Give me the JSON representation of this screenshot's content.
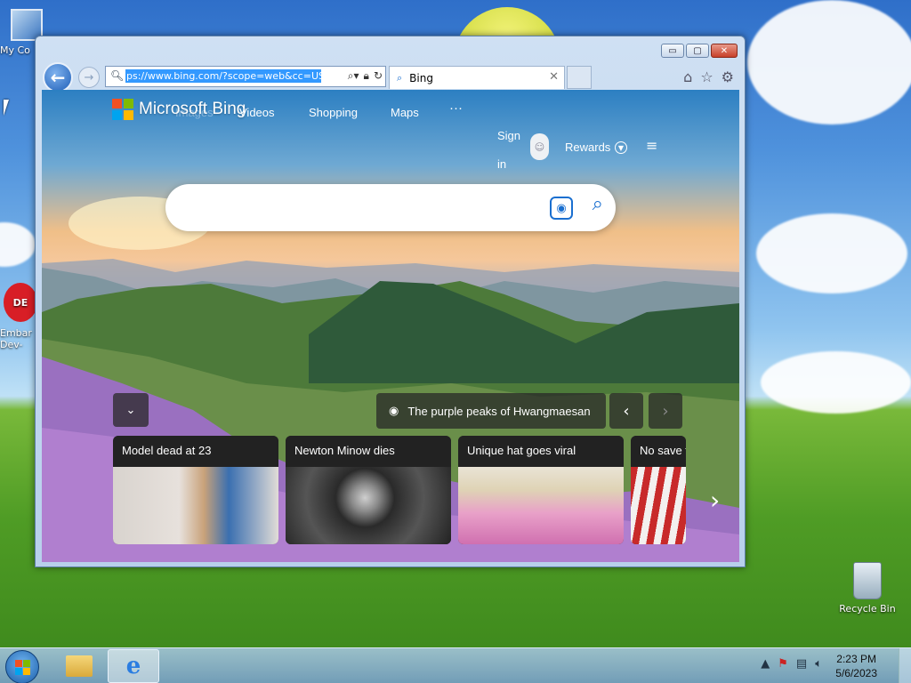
{
  "desktop": {
    "icons": [
      {
        "label": "My Co"
      },
      {
        "label": "Embar Dev-"
      },
      {
        "label": "Recycle Bin"
      }
    ]
  },
  "window": {
    "caption_buttons": {
      "minimize": "▭",
      "maximize": "▢",
      "close": "✕"
    },
    "address": {
      "url": "ps://www.bing.com/?scope=web&cc=US"
    },
    "tab": {
      "title": "Bing",
      "close": "✕"
    }
  },
  "bing": {
    "logo_text": "Microsoft Bing",
    "nav": [
      "Images",
      "Videos",
      "Shopping",
      "Maps",
      "···"
    ],
    "sign_in": "Sign in",
    "rewards": "Rewards",
    "image_caption": "The purple peaks of Hwangmaesan",
    "cards": [
      {
        "title": "Model dead at 23"
      },
      {
        "title": "Newton Minow dies"
      },
      {
        "title": "Unique hat goes viral"
      },
      {
        "title": "No save t"
      }
    ]
  },
  "taskbar": {
    "time": "2:23 PM",
    "date": "5/6/2023"
  },
  "colors": {
    "accent": "#1a6fd0",
    "ms_red": "#f25022",
    "ms_green": "#7fba00",
    "ms_blue": "#00a4ef",
    "ms_yellow": "#ffb900"
  }
}
